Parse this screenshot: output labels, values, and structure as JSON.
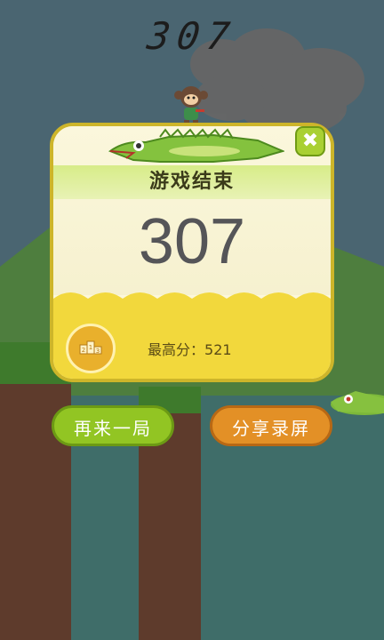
{
  "game": {
    "top_score": "307",
    "result_title": "游戏结束",
    "final_score": "307",
    "best_label": "最高分：",
    "best_score": "521",
    "close_glyph": "✖"
  },
  "buttons": {
    "restart_label": "再来一局",
    "share_label": "分享录屏"
  },
  "colors": {
    "sky": "#4f6b77",
    "card_bg": "#fbf7dc",
    "card_yellow": "#f2d83c",
    "green_button": "#92c523",
    "orange_button": "#e39026"
  },
  "icons": {
    "close": "close-icon",
    "podium": "podium-icon",
    "crocodile": "crocodile-icon",
    "monkey": "monkey-icon"
  }
}
